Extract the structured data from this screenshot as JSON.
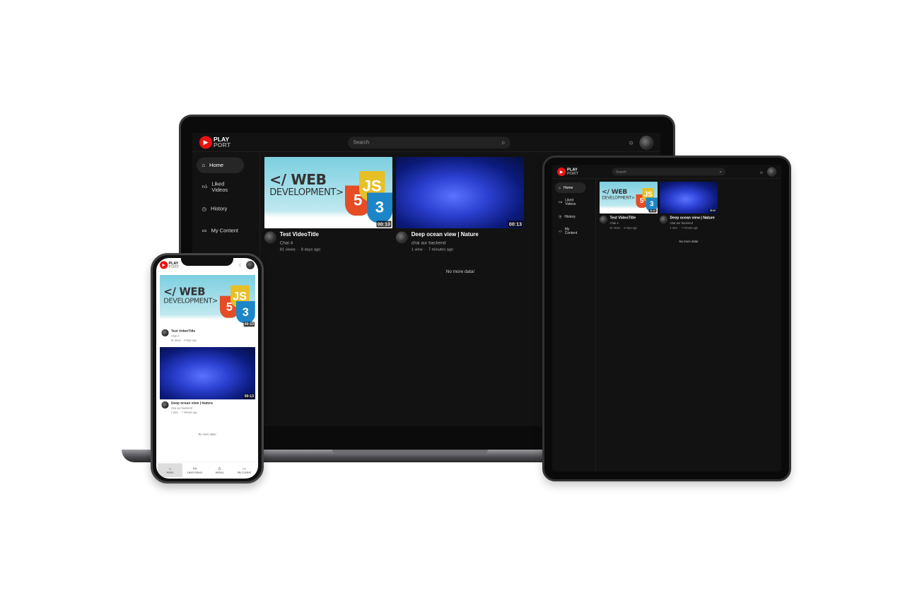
{
  "app": {
    "logo_top": "PLAY",
    "logo_bottom": "PORT",
    "search_placeholder": "Search",
    "no_more": "No more data!"
  },
  "nav": [
    {
      "label": "Home",
      "icon": "home-icon",
      "glyph": "⌂",
      "active": true
    },
    {
      "label": "Liked Videos",
      "icon": "thumbs-up-icon",
      "glyph": "👍︎",
      "active": false
    },
    {
      "label": "History",
      "icon": "history-icon",
      "glyph": "◷",
      "active": false
    },
    {
      "label": "My Content",
      "icon": "video-camera-icon",
      "glyph": "▭",
      "active": false
    }
  ],
  "videos": [
    {
      "title": "Test VideoTitle",
      "channel": "Chai 4",
      "views": "81 views",
      "age": "8 days ago",
      "duration": "00:10",
      "thumb": "web",
      "thumb_text": [
        "</ WEB",
        "DEVELOPMENT>"
      ],
      "badges": [
        "5",
        "JS",
        "3"
      ]
    },
    {
      "title": "Deep ocean view | Nature",
      "channel": "chai aur backend",
      "views": "1 view",
      "age": "7 minutes ago",
      "duration": "00:13",
      "thumb": "ocean"
    }
  ],
  "colors": {
    "brand": "#e11d1d",
    "dark_bg": "#121212",
    "html5": "#e44d26",
    "js": "#e7c027",
    "css3": "#1d86c8"
  },
  "theme_icons": {
    "dark": "sun-icon",
    "light": "moon-icon"
  }
}
